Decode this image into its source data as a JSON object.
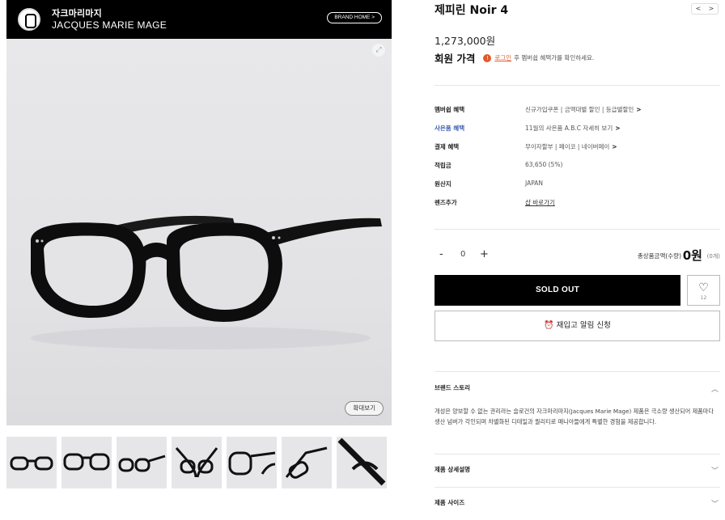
{
  "brand": {
    "name_ko": "자크마리마지",
    "name_en": "JACQUES MARIE MAGE",
    "home_label": "BRAND HOME >"
  },
  "gallery": {
    "enlarge_label": "확대보기",
    "thumbnail_count": 7
  },
  "product": {
    "title": "제피린 Noir 4",
    "nav_prev": "<",
    "nav_next": ">",
    "price": "1,273,000원",
    "member_price_label": "회원 가격",
    "login_link": "로그인",
    "member_price_note": "후 멤버쉽 혜택가를 확인하세요."
  },
  "specs": [
    {
      "key": "멤버쉽 혜택",
      "value": "신규가입쿠폰 | 금액대별 할인 | 등급별할인",
      "chevron": ">"
    },
    {
      "key": "사은품 혜택",
      "value": "11월의 사은품 A.B.C 자세히 보기",
      "chevron": ">"
    },
    {
      "key": "결제 혜택",
      "value": "무이자할부 | 페이코 | 네이버페이",
      "chevron": ">"
    },
    {
      "key": "적립금",
      "value": "63,650 (5%)",
      "chevron": ""
    },
    {
      "key": "원산지",
      "value": "JAPAN",
      "chevron": ""
    },
    {
      "key": "렌즈추가",
      "value": "샵 바로가기",
      "chevron": ""
    }
  ],
  "quantity": {
    "minus": "-",
    "value": "0",
    "plus": "+",
    "total_label": "총상품금액(수량)",
    "total_value": "0원",
    "total_count": "(0개)"
  },
  "actions": {
    "soldout_label": "SOLD OUT",
    "wish_count": "12",
    "restock_label": "재입고 알림 신청"
  },
  "accordion": {
    "brand_story_title": "브랜드 스토리",
    "brand_story_text": "개성은 양보할 수 없는 권리라는 슬로건의 자크마리마지(Jacques Marie Mage) 제품은 극소량 생산되어 제품마다 생산 넘버가 각인되며 차별화된 디테일과 퀄리티로 매니아들에게 특별한 경험을 제공합니다.",
    "detail_title": "제품 상세설명",
    "size_title": "제품 사이즈"
  },
  "colors": {
    "accent_orange": "#e05a2b",
    "accent_blue": "#3a5cb0",
    "button_black": "#000000"
  }
}
